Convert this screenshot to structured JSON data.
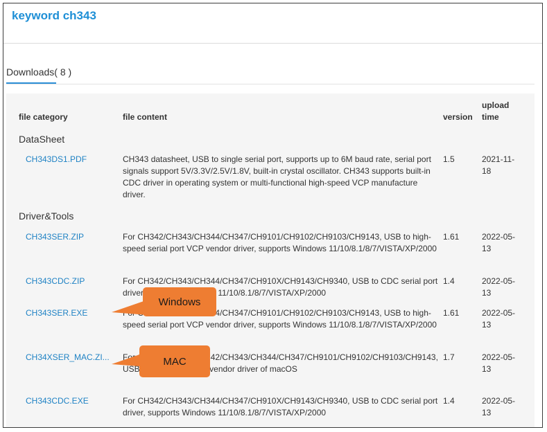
{
  "header": {
    "title": "keyword ch343"
  },
  "tabs": [
    {
      "label": "Downloads( 8 )"
    }
  ],
  "table": {
    "headers": {
      "category": "file category",
      "content": "file content",
      "version": "version",
      "upload_line1": "upload",
      "upload_line2": "time"
    },
    "categories": [
      "DataSheet",
      "Driver&Tools"
    ],
    "rows": [
      {
        "name": "CH343DS1.PDF",
        "desc": "CH343 datasheet, USB to single serial port, supports up to 6M baud rate, serial port signals support 5V/3.3V/2.5V/1.8V, built-in crystal oscillator. CH343 supports built-in CDC driver in operating system or multi-functional high-speed VCP manufacture driver.",
        "version": "1.5",
        "date": "2021-11-18"
      },
      {
        "name": "CH343SER.ZIP",
        "desc": "For CH342/CH343/CH344/CH347/CH9101/CH9102/CH9103/CH9143, USB to high-speed serial port VCP vendor driver, supports Windows 11/10/8.1/8/7/VISTA/XP/2000",
        "version": "1.61",
        "date": "2022-05-13"
      },
      {
        "name": "CH343CDC.ZIP",
        "desc": "For CH342/CH343/CH344/CH347/CH910X/CH9143/CH9340, USB to CDC serial port driver, supports Windows 11/10/8.1/8/7/VISTA/XP/2000",
        "version": "1.4",
        "date": "2022-05-13"
      },
      {
        "name": "CH343SER.EXE",
        "desc": "For CH342/CH343/CH344/CH347/CH9101/CH9102/CH9103/CH9143, USB to high-speed serial port VCP vendor driver, supports Windows 11/10/8.1/8/7/VISTA/XP/2000",
        "version": "1.61",
        "date": "2022-05-13"
      },
      {
        "name": "CH34XSER_MAC.ZI...",
        "desc": "For CH340/CH341/CH342/CH343/CH344/CH347/CH9101/CH9102/CH9103/CH9143, USB to serial port VCP vendor driver of macOS",
        "version": "1.7",
        "date": "2022-05-13"
      },
      {
        "name": "CH343CDC.EXE",
        "desc": "For CH342/CH343/CH344/CH347/CH910X/CH9143/CH9340, USB to CDC serial port driver, supports Windows 11/10/8.1/8/7/VISTA/XP/2000",
        "version": "1.4",
        "date": "2022-05-13"
      }
    ]
  },
  "callouts": {
    "windows": "Windows",
    "mac": "MAC"
  },
  "colors": {
    "title": "#1e8fd6",
    "link": "#1f82c4",
    "tab_underline": "#2a8ed6",
    "callout": "#ee7d32",
    "table_bg": "#f5f5f5"
  }
}
